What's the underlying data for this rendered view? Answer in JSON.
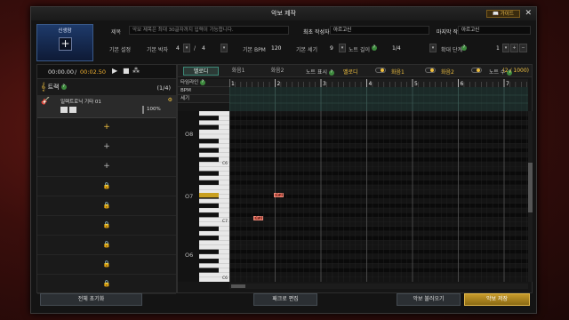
{
  "window": {
    "title": "악보 제작",
    "guide_label": "가이드",
    "close_glyph": "✕"
  },
  "avatar": {
    "name": "신생맘"
  },
  "header": {
    "title_label": "제목",
    "title_placeholder": "악보 제목은 최대 30글자까지 입력이 가능합니다.",
    "first_author_label": "최초 작성자",
    "first_author_value": "아르고신",
    "last_author_label": "마지막 작성자",
    "last_author_value": "아르고신",
    "basic_settings_label": "기본 설정",
    "time_sig_label": "기본 박자",
    "time_sig_num": "4",
    "time_sig_sep": "/",
    "time_sig_den": "4",
    "bpm_label": "기본 BPM",
    "bpm_value": "120",
    "velocity_label": "기본 세기",
    "velocity_value": "9",
    "note_length_label": "노트 길이",
    "note_length_value": "1/4",
    "zoom_label": "확대 단계",
    "zoom_value": "1"
  },
  "transport": {
    "time_current": "00:00.00",
    "time_sep": "/",
    "time_total": "00:02.50"
  },
  "tracks": {
    "header_label": "트랙",
    "count": "(1/4)",
    "track1": {
      "name": "일렉트로닉 기타 01",
      "volume": "100%"
    }
  },
  "tabs": {
    "melody": "멜로디",
    "chord1": "화음1",
    "chord2": "화음2"
  },
  "note_display": {
    "label": "노트 표시",
    "melody": "멜로디",
    "chord1": "화음1",
    "chord2": "화음2",
    "count_label": "노트 수",
    "count_value": "(2 / 1000)"
  },
  "lanes": {
    "timeline": "타임라인",
    "bpm": "BPM",
    "velocity": "세기"
  },
  "ruler": {
    "measures": [
      "1",
      "2",
      "3",
      "4",
      "5",
      "6",
      "7"
    ]
  },
  "keys": {
    "octaves": [
      "O8",
      "O7",
      "O6"
    ],
    "c_labels": [
      "C6",
      "C7",
      "C6"
    ]
  },
  "notes": {
    "note1": "C#7",
    "note2": "C#7"
  },
  "footer": {
    "reset": "전체 초기화",
    "batch_edit": "패크로 편집",
    "load": "악보 불러오기",
    "save": "악보 저장"
  }
}
